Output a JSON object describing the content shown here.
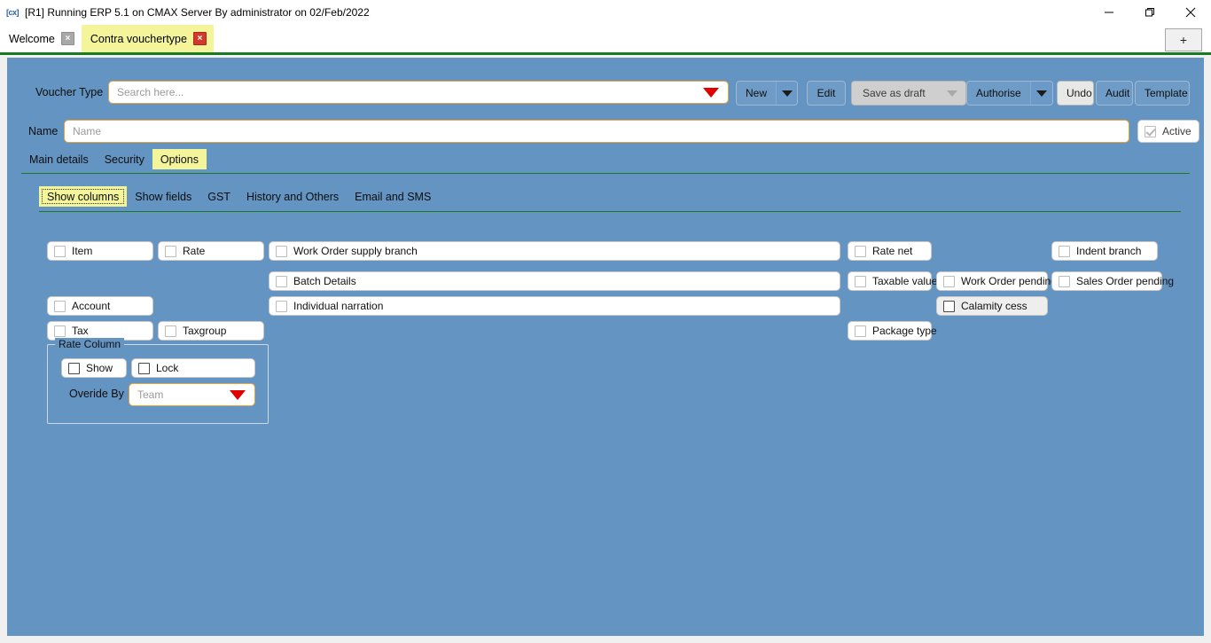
{
  "window": {
    "icon": "app-icon",
    "title": "[R1] Running ERP 5.1 on CMAX Server By administrator on 02/Feb/2022",
    "minimize_label": "minimize-icon",
    "maximize_label": "maximize-icon",
    "close_label": "close-icon"
  },
  "tabs": {
    "items": [
      {
        "label": "Welcome",
        "close": "×",
        "active": false
      },
      {
        "label": "Contra vouchertype",
        "close": "×",
        "active": true
      }
    ],
    "add_label": "+"
  },
  "form": {
    "voucher_type_label": "Voucher Type",
    "voucher_type_placeholder": "Search here...",
    "voucher_type_value": "",
    "name_label": "Name",
    "name_placeholder": "Name",
    "name_value": "",
    "active_label": "Active",
    "active_checked": true
  },
  "toolbar": {
    "new_label": "New",
    "edit_label": "Edit",
    "save_as_draft_label": "Save as draft",
    "authorise_label": "Authorise",
    "undo_label": "Undo",
    "audit_label": "Audit",
    "template_label": "Template"
  },
  "main_tabs": [
    {
      "label": "Main details",
      "active": false
    },
    {
      "label": "Security",
      "active": false
    },
    {
      "label": "Options",
      "active": true
    }
  ],
  "sub_tabs": [
    {
      "label": "Show columns",
      "active": true
    },
    {
      "label": "Show fields",
      "active": false
    },
    {
      "label": "GST",
      "active": false
    },
    {
      "label": "History and Others",
      "active": false
    },
    {
      "label": "Email and SMS",
      "active": false
    }
  ],
  "checkboxes": {
    "item": {
      "label": "Item",
      "checked": false
    },
    "rate": {
      "label": "Rate",
      "checked": false
    },
    "work_order_supply_branch": {
      "label": "Work Order supply branch",
      "checked": false
    },
    "rate_net": {
      "label": "Rate net",
      "checked": false
    },
    "indent_branch": {
      "label": "Indent branch",
      "checked": false
    },
    "batch_details": {
      "label": "Batch Details",
      "checked": false
    },
    "taxable_value": {
      "label": "Taxable value",
      "checked": false
    },
    "work_order_pending": {
      "label": "Work Order pending",
      "checked": false
    },
    "sales_order_pending": {
      "label": "Sales Order pending",
      "checked": false
    },
    "account": {
      "label": "Account",
      "checked": false
    },
    "individual_narration": {
      "label": "Individual narration",
      "checked": false
    },
    "calamity_cess": {
      "label": "Calamity cess",
      "checked": false
    },
    "tax": {
      "label": "Tax",
      "checked": false
    },
    "taxgroup": {
      "label": "Taxgroup",
      "checked": false
    },
    "package_type": {
      "label": "Package type",
      "checked": false
    }
  },
  "rate_column": {
    "title": "Rate Column",
    "show_label": "Show",
    "show_checked": false,
    "lock_label": "Lock",
    "lock_checked": false,
    "overide_by_label": "Overide By",
    "overide_by_placeholder": "Team",
    "overide_by_value": ""
  },
  "colors": {
    "panel_bg": "#6494c2",
    "accent_green": "#1a7a22",
    "active_tab": "#f4f59a",
    "field_border": "#e8a33d",
    "caret_red": "#e00000",
    "close_red": "#d13a2a"
  }
}
